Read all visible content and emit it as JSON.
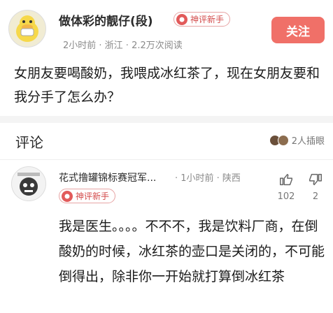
{
  "post": {
    "author": "做体彩的靓仔(段)",
    "badge": "神评新手",
    "meta": "2小时前 · 浙江 · 2.2万次阅读",
    "follow_label": "关注",
    "body": "女朋友要喝酸奶，我喂成冰红茶了，现在女朋友要和我分手了怎么办？"
  },
  "comments": {
    "title": "评论",
    "cheer_text": "2人插眼"
  },
  "comment": {
    "author": "花式撸罐锦标赛冠军...",
    "meta": "· 1小时前 · 陕西",
    "badge": "神评新手",
    "likes": "102",
    "dislikes": "2",
    "body": "我是医生。。。。不不不，我是饮料厂商，在倒酸奶的时候，冰红茶的壶口是关闭的，不可能倒得出，除非你一开始就打算倒冰红茶"
  },
  "colors": {
    "accent": "#f07068",
    "badge": "#d34b4b"
  }
}
